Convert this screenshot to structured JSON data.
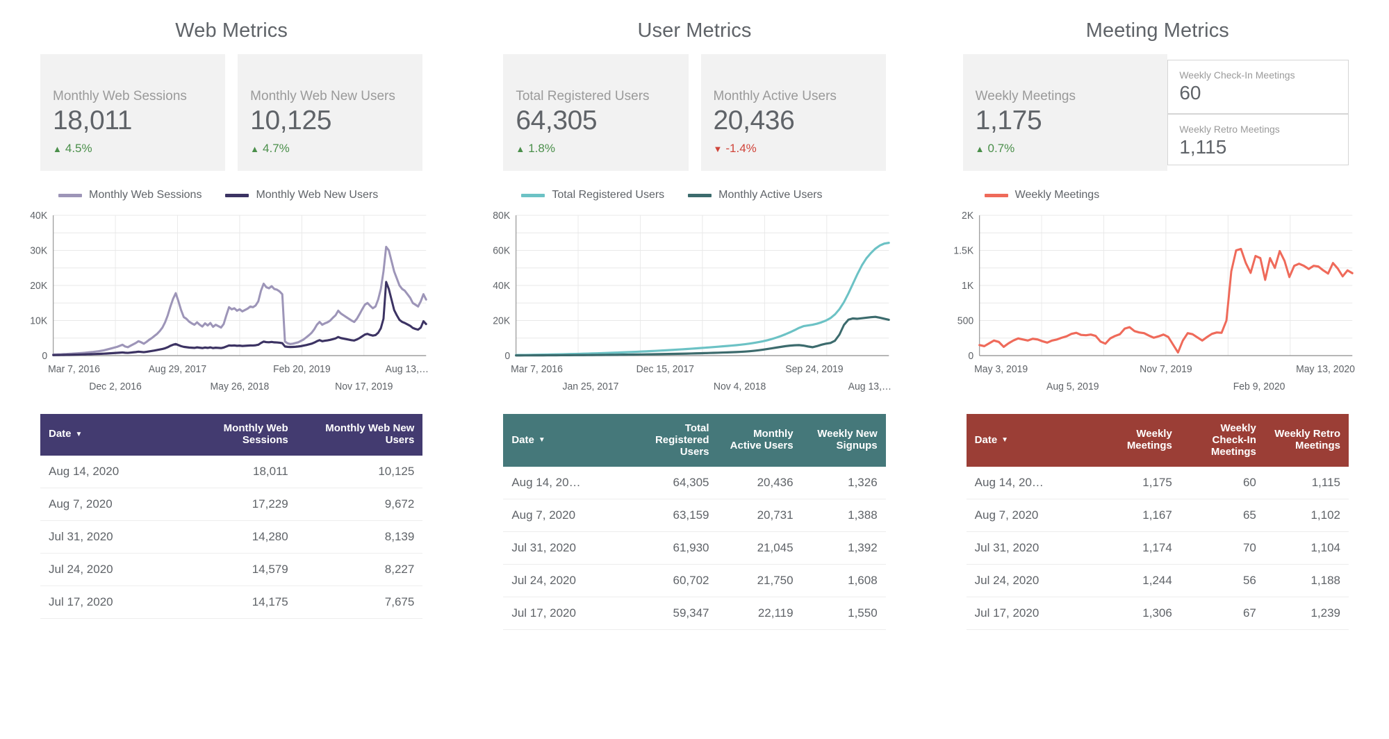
{
  "panels": [
    {
      "title": "Web Metrics",
      "accent": "#433b70",
      "scorecards": [
        {
          "label": "Monthly Web Sessions",
          "value": "18,011",
          "delta": "4.5%",
          "direction": "up",
          "arrow": "▲"
        },
        {
          "label": "Monthly Web New Users",
          "value": "10,125",
          "delta": "4.7%",
          "direction": "up",
          "arrow": "▲"
        }
      ],
      "mini_cards": [],
      "legend": [
        {
          "label": "Monthly Web Sessions",
          "color": "#9d95b8"
        },
        {
          "label": "Monthly Web New Users",
          "color": "#3c3363"
        }
      ],
      "table": {
        "columns": [
          "Date",
          "Monthly Web Sessions",
          "Monthly Web New Users"
        ],
        "rows": [
          [
            "Aug 14, 2020",
            "18,011",
            "10,125"
          ],
          [
            "Aug 7, 2020",
            "17,229",
            "9,672"
          ],
          [
            "Jul 31, 2020",
            "14,280",
            "8,139"
          ],
          [
            "Jul 24, 2020",
            "14,579",
            "8,227"
          ],
          [
            "Jul 17, 2020",
            "14,175",
            "7,675"
          ]
        ]
      }
    },
    {
      "title": "User Metrics",
      "accent": "#45787a",
      "scorecards": [
        {
          "label": "Total Registered Users",
          "value": "64,305",
          "delta": "1.8%",
          "direction": "up",
          "arrow": "▲"
        },
        {
          "label": "Monthly Active Users",
          "value": "20,436",
          "delta": "-1.4%",
          "direction": "down",
          "arrow": "▼"
        }
      ],
      "mini_cards": [],
      "legend": [
        {
          "label": "Total Registered Users",
          "color": "#6cc2c5"
        },
        {
          "label": "Monthly Active Users",
          "color": "#3c6b6d"
        }
      ],
      "table": {
        "columns": [
          "Date",
          "Total Registered Users",
          "Monthly Active Users",
          "Weekly New Signups"
        ],
        "rows": [
          [
            "Aug 14, 20…",
            "64,305",
            "20,436",
            "1,326"
          ],
          [
            "Aug 7, 2020",
            "63,159",
            "20,731",
            "1,388"
          ],
          [
            "Jul 31, 2020",
            "61,930",
            "21,045",
            "1,392"
          ],
          [
            "Jul 24, 2020",
            "60,702",
            "21,750",
            "1,608"
          ],
          [
            "Jul 17, 2020",
            "59,347",
            "22,119",
            "1,550"
          ]
        ]
      }
    },
    {
      "title": "Meeting Metrics",
      "accent": "#9b3e36",
      "scorecards": [
        {
          "label": "Weekly Meetings",
          "value": "1,175",
          "delta": "0.7%",
          "direction": "up",
          "arrow": "▲"
        }
      ],
      "mini_cards": [
        {
          "label": "Weekly Check-In Meetings",
          "value": "60"
        },
        {
          "label": "Weekly Retro Meetings",
          "value": "1,115"
        }
      ],
      "legend": [
        {
          "label": "Weekly Meetings",
          "color": "#ef6a5a"
        }
      ],
      "table": {
        "columns": [
          "Date",
          "Weekly Meetings",
          "Weekly Check-In Meetings",
          "Weekly Retro Meetings"
        ],
        "rows": [
          [
            "Aug 14, 20…",
            "1,175",
            "60",
            "1,115"
          ],
          [
            "Aug 7, 2020",
            "1,167",
            "65",
            "1,102"
          ],
          [
            "Jul 31, 2020",
            "1,174",
            "70",
            "1,104"
          ],
          [
            "Jul 24, 2020",
            "1,244",
            "56",
            "1,188"
          ],
          [
            "Jul 17, 2020",
            "1,306",
            "67",
            "1,239"
          ]
        ]
      }
    }
  ],
  "chart_data": [
    {
      "type": "line",
      "title": "Web Metrics",
      "xlabel": "",
      "ylabel": "",
      "ylim": [
        0,
        40000
      ],
      "yticks": [
        "0",
        "10K",
        "20K",
        "30K",
        "40K"
      ],
      "grid": true,
      "legend_position": "top-left",
      "xticks": [
        "Mar 7, 2016",
        "Dec 2, 2016",
        "Aug 29, 2017",
        "May 26, 2018",
        "Feb 20, 2019",
        "Nov 17, 2019",
        "Aug 13,…"
      ],
      "series": [
        {
          "name": "Monthly Web Sessions",
          "color": "#9d95b8",
          "values": [
            300,
            320,
            360,
            380,
            420,
            450,
            500,
            540,
            600,
            650,
            700,
            760,
            820,
            900,
            980,
            1050,
            1150,
            1250,
            1380,
            1500,
            1700,
            1900,
            2100,
            2300,
            2500,
            2800,
            3100,
            2600,
            2400,
            2800,
            3200,
            3600,
            4100,
            3800,
            3400,
            3900,
            4500,
            5000,
            5600,
            6200,
            7000,
            8000,
            9500,
            11500,
            14000,
            16200,
            17800,
            15500,
            13000,
            11000,
            10500,
            9700,
            9200,
            8800,
            9500,
            8800,
            8300,
            9200,
            8600,
            9300,
            8200,
            8800,
            8400,
            8000,
            9000,
            11500,
            13800,
            13200,
            13500,
            12800,
            13200,
            12600,
            13000,
            13400,
            14000,
            13800,
            14300,
            15500,
            18500,
            20500,
            19500,
            19200,
            19800,
            19000,
            18800,
            18300,
            17500,
            4000,
            3500,
            3300,
            3400,
            3600,
            3800,
            4200,
            4600,
            5200,
            5800,
            6500,
            7500,
            8800,
            9600,
            8800,
            9200,
            9500,
            10000,
            10800,
            11500,
            12800,
            12000,
            11500,
            11000,
            10500,
            10000,
            9600,
            10500,
            11800,
            13200,
            14500,
            15000,
            14200,
            13500,
            14000,
            16000,
            19000,
            24000,
            31000,
            30000,
            27000,
            24000,
            22000,
            20000,
            19000,
            18500,
            17500,
            16500,
            15000,
            14500,
            14000,
            15500,
            17500,
            16000
          ],
          "last_value": 18011
        },
        {
          "name": "Monthly Web New Users",
          "color": "#3c3363",
          "values": [
            150,
            160,
            170,
            185,
            200,
            215,
            230,
            250,
            270,
            290,
            310,
            330,
            350,
            380,
            400,
            430,
            460,
            490,
            520,
            560,
            600,
            640,
            690,
            740,
            790,
            840,
            900,
            820,
            780,
            860,
            940,
            1020,
            1120,
            1050,
            980,
            1080,
            1200,
            1320,
            1450,
            1600,
            1750,
            1900,
            2100,
            2400,
            2800,
            3100,
            3300,
            3000,
            2700,
            2500,
            2400,
            2300,
            2250,
            2200,
            2350,
            2250,
            2150,
            2300,
            2200,
            2350,
            2150,
            2250,
            2200,
            2150,
            2300,
            2600,
            2900,
            2850,
            2900,
            2800,
            2850,
            2750,
            2800,
            2850,
            2900,
            2880,
            2950,
            3100,
            3600,
            4000,
            3850,
            3800,
            3900,
            3780,
            3750,
            3680,
            3550,
            2600,
            2500,
            2450,
            2480,
            2520,
            2600,
            2700,
            2850,
            3000,
            3200,
            3400,
            3700,
            4100,
            4400,
            4100,
            4250,
            4350,
            4500,
            4700,
            4900,
            5300,
            5000,
            4850,
            4700,
            4550,
            4400,
            4300,
            4600,
            5000,
            5500,
            6000,
            6200,
            5900,
            5700,
            5850,
            6500,
            7800,
            10500,
            21000,
            19000,
            16000,
            13000,
            11500,
            10200,
            9600,
            9300,
            8900,
            8500,
            7900,
            7600,
            7400,
            8000,
            9800,
            9000
          ],
          "last_value": 10125
        }
      ]
    },
    {
      "type": "line",
      "title": "User Metrics",
      "xlabel": "",
      "ylabel": "",
      "ylim": [
        0,
        80000
      ],
      "yticks": [
        "0",
        "20K",
        "40K",
        "60K",
        "80K"
      ],
      "grid": true,
      "legend_position": "top-left",
      "xticks": [
        "Mar 7, 2016",
        "Jan 25, 2017",
        "Dec 15, 2017",
        "Nov 4, 2018",
        "Sep 24, 2019",
        "Aug 13,…"
      ],
      "series": [
        {
          "name": "Total Registered Users",
          "color": "#6cc2c5",
          "values": [
            300,
            340,
            380,
            420,
            460,
            500,
            550,
            600,
            650,
            700,
            760,
            820,
            880,
            950,
            1020,
            1090,
            1160,
            1240,
            1320,
            1400,
            1490,
            1580,
            1670,
            1770,
            1870,
            1980,
            2090,
            2200,
            2320,
            2440,
            2570,
            2700,
            2840,
            2980,
            3130,
            3280,
            3440,
            3600,
            3770,
            3940,
            4120,
            4300,
            4490,
            4680,
            4880,
            5080,
            5290,
            5500,
            5720,
            5950,
            6200,
            6500,
            6850,
            7250,
            7700,
            8200,
            8800,
            9500,
            10300,
            11200,
            12200,
            13300,
            14500,
            15800,
            16800,
            17200,
            17600,
            18200,
            19000,
            20000,
            21400,
            23500,
            26500,
            30500,
            35500,
            41000,
            46500,
            51500,
            55500,
            58500,
            61000,
            62800,
            63900,
            64305
          ],
          "last_value": 64305
        },
        {
          "name": "Monthly Active Users",
          "color": "#3c6b6d",
          "values": [
            100,
            110,
            120,
            130,
            140,
            150,
            160,
            175,
            190,
            205,
            220,
            235,
            250,
            270,
            290,
            310,
            330,
            350,
            375,
            400,
            425,
            450,
            480,
            510,
            540,
            570,
            600,
            635,
            670,
            710,
            750,
            790,
            830,
            880,
            930,
            980,
            1030,
            1090,
            1150,
            1210,
            1280,
            1350,
            1420,
            1500,
            1580,
            1660,
            1750,
            1840,
            1940,
            2040,
            2150,
            2300,
            2500,
            2750,
            3050,
            3400,
            3800,
            4200,
            4600,
            5000,
            5400,
            5700,
            5900,
            6000,
            5700,
            5200,
            4800,
            5400,
            6200,
            6800,
            7200,
            8500,
            12000,
            17500,
            20500,
            21200,
            21000,
            21300,
            21600,
            21900,
            22100,
            21600,
            21000,
            20436
          ],
          "last_value": 20436
        }
      ]
    },
    {
      "type": "line",
      "title": "Meeting Metrics",
      "xlabel": "",
      "ylabel": "",
      "ylim": [
        0,
        2000
      ],
      "yticks": [
        "0",
        "500",
        "1K",
        "1.5K",
        "2K"
      ],
      "grid": true,
      "legend_position": "top-left",
      "xticks": [
        "May 3, 2019",
        "Aug 5, 2019",
        "Nov 7, 2019",
        "Feb 9, 2020",
        "May 13, 2020"
      ],
      "series": [
        {
          "name": "Weekly Meetings",
          "color": "#ef6a5a",
          "values": [
            150,
            135,
            175,
            215,
            195,
            125,
            175,
            215,
            245,
            230,
            215,
            240,
            230,
            205,
            185,
            215,
            230,
            255,
            275,
            310,
            325,
            295,
            290,
            300,
            280,
            200,
            170,
            245,
            280,
            305,
            385,
            405,
            350,
            330,
            320,
            285,
            255,
            275,
            300,
            265,
            155,
            45,
            215,
            320,
            305,
            260,
            215,
            265,
            310,
            330,
            325,
            500,
            1200,
            1500,
            1520,
            1320,
            1180,
            1420,
            1390,
            1080,
            1390,
            1250,
            1490,
            1350,
            1120,
            1280,
            1310,
            1280,
            1235,
            1280,
            1270,
            1215,
            1170,
            1320,
            1240,
            1130,
            1215,
            1175
          ],
          "last_value": 1175
        }
      ]
    }
  ]
}
